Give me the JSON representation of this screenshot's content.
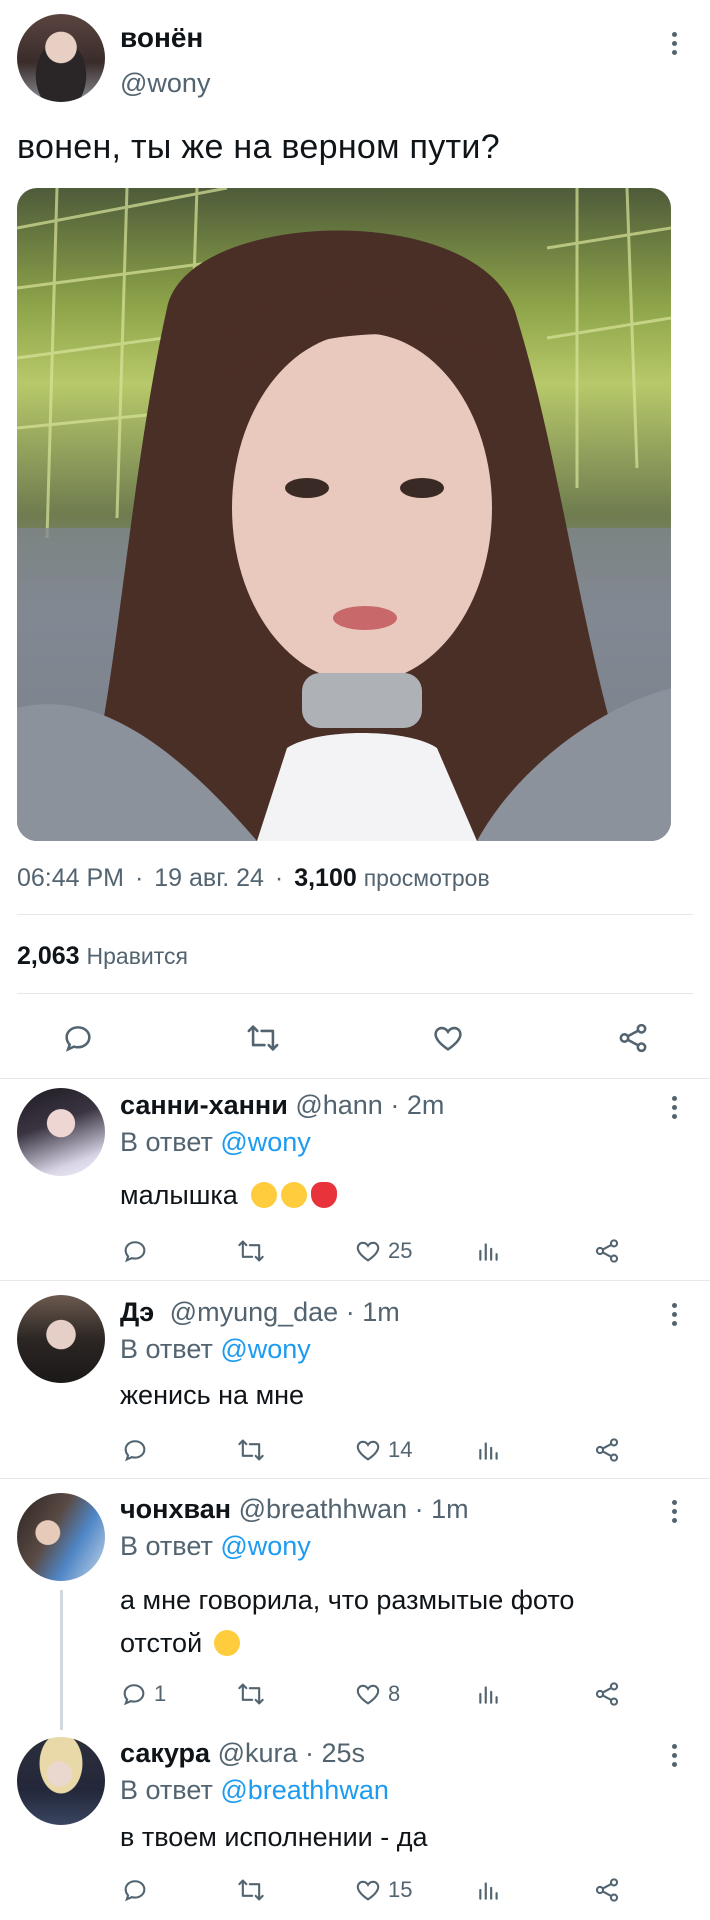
{
  "tweet": {
    "author_name": "вонён",
    "author_handle": "@wony",
    "text": "вонен, ты же на верном пути?",
    "time": "06:44 PM",
    "date": "19 авг. 24",
    "views_count": "3,100",
    "views_label": "просмотров",
    "likes_count": "2,063",
    "likes_label": "Нравится",
    "sep": "·"
  },
  "replies": [
    {
      "name": "санни-ханни",
      "handle": "@hann",
      "time": "· 2m",
      "reply_prefix": "В ответ",
      "reply_to": "@wony",
      "text_line1": "малышка",
      "emoji": [
        "tired-face-emoji",
        "tired-face-emoji",
        "strawberry-emoji"
      ],
      "comments": "",
      "likes": "25"
    },
    {
      "name": "Дэ",
      "handle": "@myung_dae",
      "time": "· 1m",
      "reply_prefix": "В ответ",
      "reply_to": "@wony",
      "text_line1": "женись на мне",
      "comments": "",
      "likes": "14"
    },
    {
      "name": "чонхван",
      "handle": "@breathhwan",
      "time": "· 1m",
      "reply_prefix": "В ответ",
      "reply_to": "@wony",
      "text_line1": "а мне говорила, что размытые фото",
      "text_line2": "отстой",
      "emoji": [
        "dizzy-eyes-emoji"
      ],
      "comments": "1",
      "likes": "8"
    },
    {
      "name": "сакура",
      "handle": "@kura",
      "time": "· 25s",
      "reply_prefix": "В ответ",
      "reply_to": "@breathhwan",
      "text_line1": "в твоем исполнении - да",
      "comments": "",
      "likes": "15"
    }
  ],
  "colors": {
    "text": "#0f1419",
    "secondary": "#536471",
    "link": "#1d9bf0",
    "divider": "#e6e9ec"
  },
  "icons": [
    "more-icon",
    "comment-icon",
    "retweet-icon",
    "heart-icon",
    "share-icon",
    "views-icon"
  ]
}
